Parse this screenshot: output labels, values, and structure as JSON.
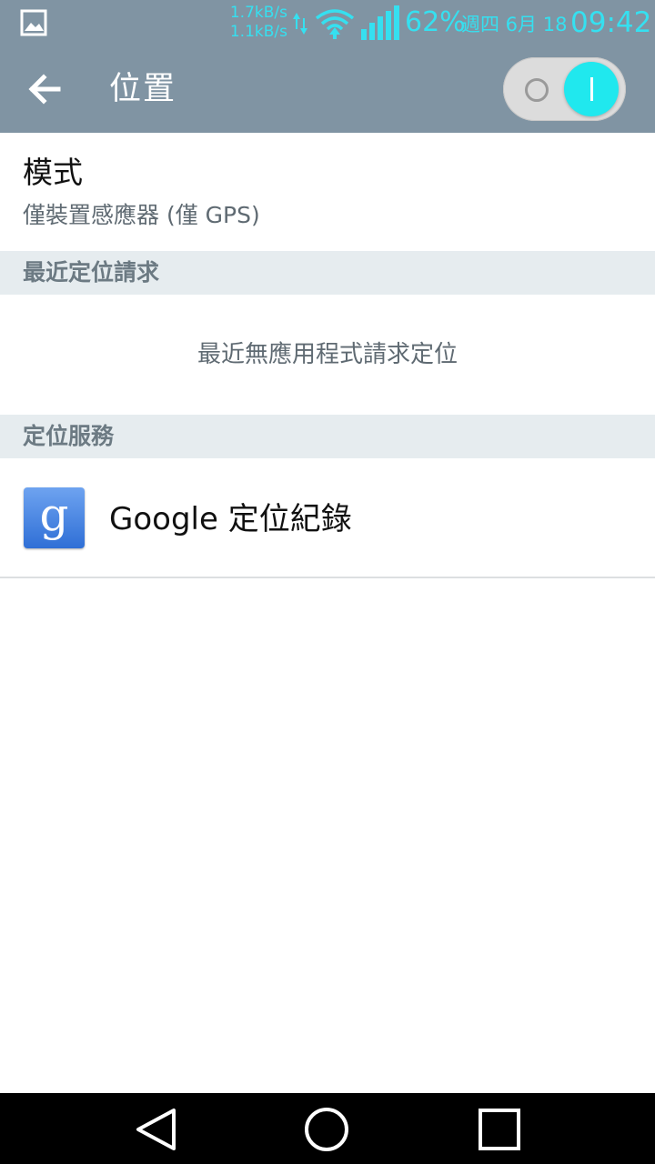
{
  "status_bar": {
    "speed_up": "1.7kB/s",
    "speed_down": "1.1kB/s",
    "battery": "62%",
    "date": "週四 6月 18",
    "time": "09:42",
    "icons": [
      "gallery-icon",
      "data-arrows-icon",
      "wifi-icon",
      "signal-icon"
    ],
    "accent_color": "#35e0f0"
  },
  "action_bar": {
    "title": "位置",
    "back_icon": "arrow-left-icon",
    "toggle_on": true,
    "toggle_color": "#20e8ee",
    "background_color": "#8094a3"
  },
  "mode": {
    "title": "模式",
    "summary": "僅裝置感應器 (僅 GPS)"
  },
  "recent_requests": {
    "header": "最近定位請求",
    "empty_text": "最近無應用程式請求定位"
  },
  "location_services": {
    "header": "定位服務",
    "items": [
      {
        "icon": "google-icon",
        "icon_letter": "g",
        "label": "Google 定位紀錄"
      }
    ]
  },
  "nav_bar": {
    "buttons": [
      "back-icon",
      "home-icon",
      "recents-icon"
    ]
  }
}
